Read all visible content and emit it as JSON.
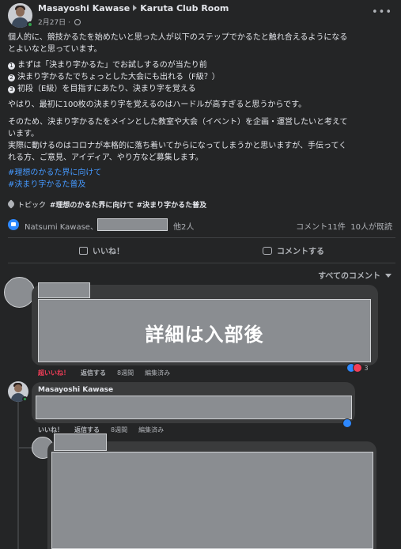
{
  "post": {
    "author": "Masayoshi Kawase",
    "group": "Karuta Club Room",
    "date": "2月27日",
    "paragraphs": {
      "p1_line1": "個人的に、競技かるたを始めたいと思った人が以下のステップでかるたと触れ合えるようになる",
      "p1_line2": "とよいなと思っています。",
      "step1_num": "1",
      "step1": "まずは「決まり字かるた」でお試しするのが当たり前",
      "step2_num": "2",
      "step2": "決まり字かるたでちょっとした大会にも出れる（F級？）",
      "step3_num": "3",
      "step3": "初段（E級）を目指すにあたり、決まり字を覚える",
      "p2": "やはり、最初に100枚の決まり字を覚えるのはハードルが高すぎると思うからです。",
      "p3_line1": "そのため、決まり字かるたをメインとした教室や大会（イベント）を企画・運営したいと考えて",
      "p3_line2": "います。",
      "p4_line1": "実際に動けるのはコロナが本格的に落ち着いてからになってしまうかと思いますが、手伝ってく",
      "p4_line2": "れる方、ご意見、アイディア、やり方など募集します。"
    },
    "hashtags": [
      "#理想のかるた界に向けて",
      "#決まり字かるた普及"
    ],
    "topic_label": "トピック",
    "topic_tags": "#理想のかるた界に向けて #決まり字かるた普及"
  },
  "reactions": {
    "first_name": "Natsumi Kawase、",
    "others": "他2人",
    "comment_count": "コメント11件",
    "views": "10人が既読"
  },
  "actions": {
    "like": "いいね！",
    "comment": "コメントする",
    "sort_label": "すべてのコメント"
  },
  "comments": [
    {
      "overlay": "詳細は入部後",
      "reaction_label": "超いいね！",
      "reply_label": "返信する",
      "age": "8週間",
      "edited": "編集済み",
      "reaction_count": "3"
    },
    {
      "author": "Masayoshi Kawase",
      "reaction_label": "いいね！",
      "reply_label": "返信する",
      "age": "8週間",
      "edited": "編集済み"
    }
  ],
  "colors": {
    "background": "#242526",
    "text": "#e4e6eb",
    "muted": "#b0b3b8",
    "link": "#4599ff",
    "like_blue": "#2d88ff",
    "love_red": "#f33e58",
    "redaction_gray": "#8a8d91"
  },
  "icons": [
    "globe-icon",
    "more-icon",
    "pin-icon",
    "like-icon",
    "love-icon",
    "comment-icon",
    "caret-down-icon"
  ]
}
